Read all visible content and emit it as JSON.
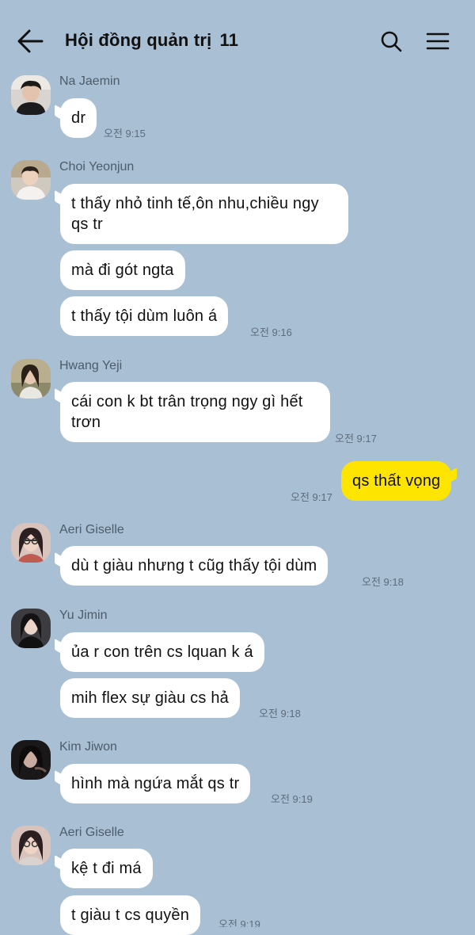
{
  "header": {
    "title": "Hội đồng quản trị",
    "member_count": "11"
  },
  "messages": [
    {
      "sender": "Na Jaemin",
      "bubbles": [
        "dr"
      ],
      "time": "오전 9:15"
    },
    {
      "sender": "Choi Yeonjun",
      "bubbles": [
        "t thấy nhỏ tinh tế,ôn nhu,chiều ngy qs tr",
        "mà đi gót ngta",
        "t thấy tội dùm luôn á"
      ],
      "time": "오전 9:16"
    },
    {
      "sender": "Hwang Yeji",
      "bubbles": [
        "cái con k bt trân trọng ngy gì hết trơn"
      ],
      "time": "오전 9:17"
    },
    {
      "sender": "me",
      "bubbles": [
        "qs thất vọng"
      ],
      "time": "오전 9:17"
    },
    {
      "sender": "Aeri Giselle",
      "bubbles": [
        "dù t giàu nhưng t cũg thấy tội dùm"
      ],
      "time": "오전 9:18"
    },
    {
      "sender": "Yu Jimin",
      "bubbles": [
        "ủa r con trên cs lquan k á",
        "mih flex sự giàu cs hả"
      ],
      "time": "오전 9:18"
    },
    {
      "sender": "Kim Jiwon",
      "bubbles": [
        "hình mà ngứa mắt qs tr"
      ],
      "time": "오전 9:19"
    },
    {
      "sender": "Aeri Giselle",
      "bubbles": [
        "kệ t đi má",
        "t giàu t cs quyền"
      ],
      "time": "오전 9:19"
    }
  ],
  "colors": {
    "background": "#a9bfd3",
    "other_bubble": "#ffffff",
    "my_bubble": "#fee500"
  },
  "icons": [
    "back-arrow-icon",
    "search-icon",
    "menu-icon"
  ]
}
